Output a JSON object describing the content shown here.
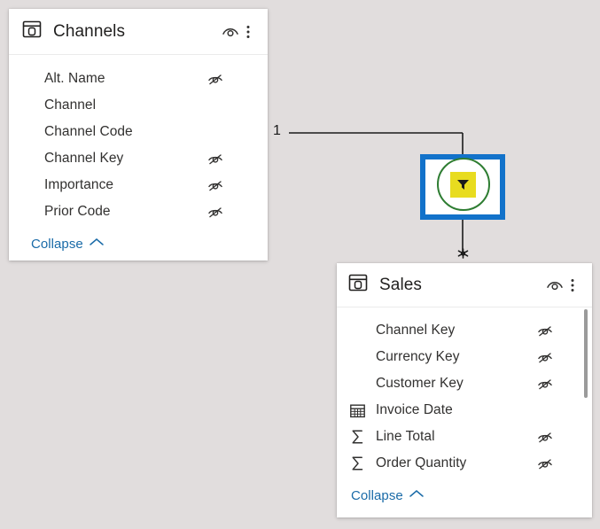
{
  "canvas": {
    "background": "#e1dddd",
    "accent_blue": "#1272ca",
    "link_blue": "#1a6ba8",
    "relationship_green": "#2e7d32",
    "filter_yellow": "#e8dc1f"
  },
  "channels_card": {
    "title": "Channels",
    "table_icon": "table-icon",
    "view_icon": "view-eye-icon",
    "menu_icon": "more-options-icon",
    "collapse_label": "Collapse",
    "collapse_chevron": "chevron-up-icon",
    "fields": [
      {
        "name": "Alt. Name",
        "type_icon": "",
        "hidden": true
      },
      {
        "name": "Channel",
        "type_icon": "",
        "hidden": false
      },
      {
        "name": "Channel Code",
        "type_icon": "",
        "hidden": false
      },
      {
        "name": "Channel Key",
        "type_icon": "",
        "hidden": true
      },
      {
        "name": "Importance",
        "type_icon": "",
        "hidden": true
      },
      {
        "name": "Prior Code",
        "type_icon": "",
        "hidden": true
      }
    ]
  },
  "sales_card": {
    "title": "Sales",
    "table_icon": "table-icon",
    "view_icon": "view-eye-icon",
    "menu_icon": "more-options-icon",
    "collapse_label": "Collapse",
    "collapse_chevron": "chevron-up-icon",
    "fields": [
      {
        "name": "Channel Key",
        "type_icon": "",
        "hidden": true
      },
      {
        "name": "Currency Key",
        "type_icon": "",
        "hidden": true
      },
      {
        "name": "Customer Key",
        "type_icon": "",
        "hidden": true
      },
      {
        "name": "Invoice Date",
        "type_icon": "calendar-icon",
        "hidden": false
      },
      {
        "name": "Line Total",
        "type_icon": "sigma-icon",
        "hidden": true
      },
      {
        "name": "Order Quantity",
        "type_icon": "sigma-icon",
        "hidden": true
      }
    ]
  },
  "relationship": {
    "one_cardinality": "1",
    "many_cardinality": "*",
    "cross_filter_icon": "filter-direction-icon",
    "selected": true
  }
}
